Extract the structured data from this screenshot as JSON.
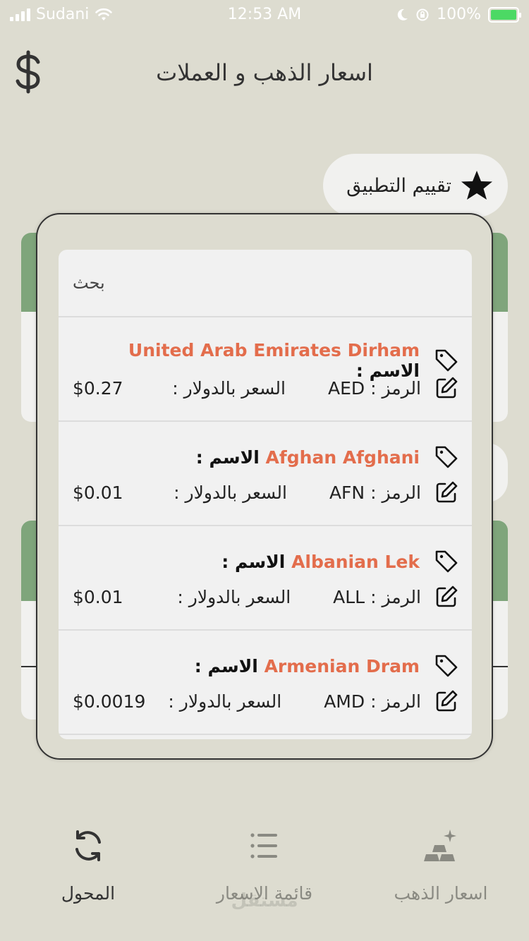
{
  "status_bar": {
    "carrier": "Sudani",
    "time": "12:53 AM",
    "battery": "100%"
  },
  "header": {
    "title": "اسعار الذهب و العملات",
    "currency_icon": "dollar-icon"
  },
  "rate_app": {
    "label": "تقييم التطبيق",
    "icon": "star-icon"
  },
  "search": {
    "placeholder": "بحث"
  },
  "currencies": [
    {
      "name_label": "الاسم :",
      "name": "United Arab Emirates Dirham",
      "symbol_label": "الرمز :",
      "symbol": "AED",
      "price_label": "السعر بالدولار :",
      "price": "$0.27"
    },
    {
      "name_label": "الاسم :",
      "name": "Afghan Afghani",
      "symbol_label": "الرمز :",
      "symbol": "AFN",
      "price_label": "السعر بالدولار :",
      "price": "$0.01"
    },
    {
      "name_label": "الاسم :",
      "name": "Albanian Lek",
      "symbol_label": "الرمز :",
      "symbol": "ALL",
      "price_label": "السعر بالدولار :",
      "price": "$0.01"
    },
    {
      "name_label": "الاسم :",
      "name": "Armenian Dram",
      "symbol_label": "الرمز :",
      "symbol": "AMD",
      "price_label": "السعر بالدولار :",
      "price": "$0.0019"
    }
  ],
  "bottom_nav": [
    {
      "label": "المحول",
      "icon": "refresh-icon",
      "active": true
    },
    {
      "label": "قائمة الاسعار",
      "icon": "list-icon",
      "active": false
    },
    {
      "label": "اسعار الذهب",
      "icon": "gold-bars-icon",
      "active": false
    }
  ],
  "watermark": "مستقل",
  "colors": {
    "background": "#dddcd0",
    "card": "#f1f1f1",
    "accent_green": "#7fa57b",
    "currency_name": "#e36d4c",
    "nav_active": "#333333",
    "nav_inactive": "#8a8a82"
  }
}
